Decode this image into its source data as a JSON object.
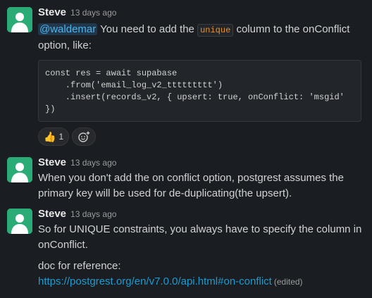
{
  "messages": [
    {
      "author": "Steve",
      "time": "13 days ago",
      "mention": "@waldemar",
      "text_before_code": " You need to add the ",
      "inline_code": "unique",
      "text_after_code": " column to the onConflict option, like:",
      "code_block": "const res = await supabase\n    .from('email_log_v2_ttttttttt')\n    .insert(records_v2, { upsert: true, onConflict: 'msgid' \n})",
      "reactions": [
        {
          "emoji": "👍",
          "count": "1"
        }
      ],
      "add_reaction_icon": "add-reaction-icon"
    },
    {
      "author": "Steve",
      "time": "13 days ago",
      "text": "When you don't add the on conflict option, postgrest assumes the primary key will be used for de-duplicating(the upsert)."
    },
    {
      "author": "Steve",
      "time": "13 days ago",
      "text": "So for UNIQUE constraints, you always have to specify the column in onConflict.",
      "text2": "doc for reference:",
      "link": "https://postgrest.org/en/v7.0.0/api.html#on-conflict",
      "edited": "(edited)"
    }
  ],
  "colors": {
    "avatar": "#2bac76",
    "link": "#1d9bd1",
    "mention": "#4db2ec",
    "inline_code": "#e8912d"
  }
}
